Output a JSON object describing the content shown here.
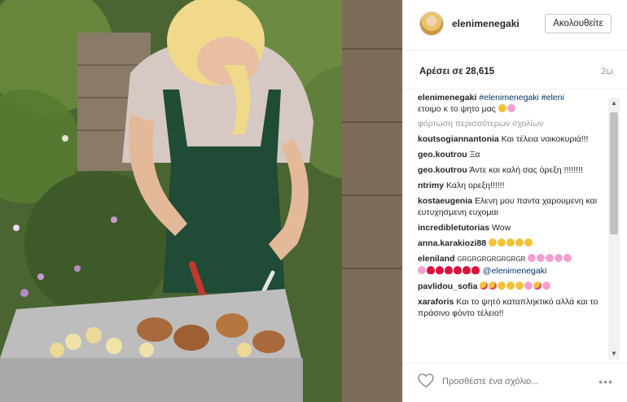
{
  "post": {
    "username": "elenimenegaki",
    "follow_label": "Ακολουθείτε",
    "likes_text": "Αρέσει σε 28,615",
    "time_ago": "2ω",
    "caption": {
      "user": "elenimenegaki",
      "hashtags": "#elenimenegaki #eleni",
      "text": "ετοιμο κ το ψητο μας"
    },
    "load_more": "φόρτωση περισσότερων σχολίων",
    "comments": [
      {
        "user": "koutsogiannantonia",
        "text": "Και τέλεια νοικοκυριά!!!"
      },
      {
        "user": "geo.koutrou",
        "text": "Ξα"
      },
      {
        "user": "geo.koutrou",
        "text": "Άντε και καλή σας όρεξη !!!!!!!!"
      },
      {
        "user": "ntrimy",
        "text": "Καλη ορεξη!!!!!!"
      },
      {
        "user": "kostaeugenia",
        "text": "Ελενη μου παντα χαρουμενη και ευτυχησμενη ευχομαι"
      },
      {
        "user": "incredibletutorias",
        "text": "Wow"
      },
      {
        "user": "anna.karakiozi88",
        "text": ""
      },
      {
        "user": "eleniland",
        "text": "GRGRGRGRGRGRGR",
        "mention": "@elenimenegaki"
      },
      {
        "user": "pavlidou_sofia",
        "text": ""
      },
      {
        "user": "xaraforis",
        "text": "Και το ψητό καταπληκτικό αλλά και το πράσινο φόντο τέλειο!!"
      }
    ],
    "comment_placeholder": "Προσθέστε ένα σχόλιο...",
    "more_label": "•••"
  },
  "icons": {
    "heart": "heart-icon",
    "more": "more-options-icon",
    "scroll_up": "scroll-up-icon",
    "scroll_down": "scroll-down-icon"
  },
  "colors": {
    "hashtag": "#003569",
    "muted": "#999999",
    "text": "#262626"
  }
}
